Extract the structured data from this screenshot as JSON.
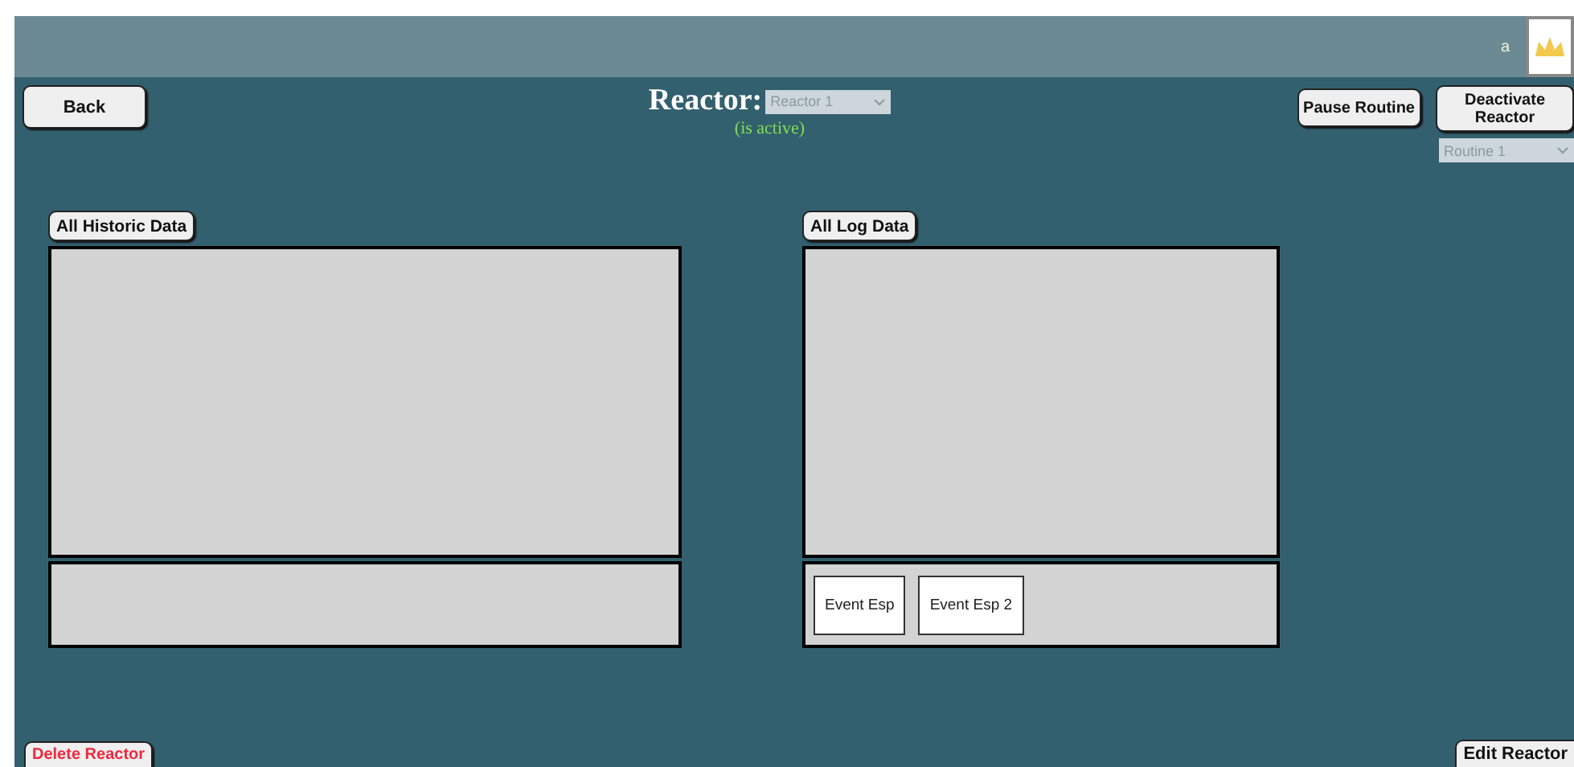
{
  "header": {
    "user": "a"
  },
  "toolbar": {
    "back": "Back",
    "title": "Reactor:",
    "reactor_select": {
      "value": "Reactor 1",
      "disabled": true
    },
    "status": "(is active)",
    "pause": "Pause Routine",
    "deactivate": "Deactivate Reactor",
    "routine_select": {
      "value": "Routine 1",
      "disabled": true
    }
  },
  "panels": [
    {
      "button": "All Historic Data"
    },
    {
      "button": "All Log Data",
      "events": [
        "Event Esp",
        "Event Esp 2"
      ]
    }
  ],
  "footer": {
    "delete": "Delete Reactor",
    "edit": "Edit Reactor"
  }
}
